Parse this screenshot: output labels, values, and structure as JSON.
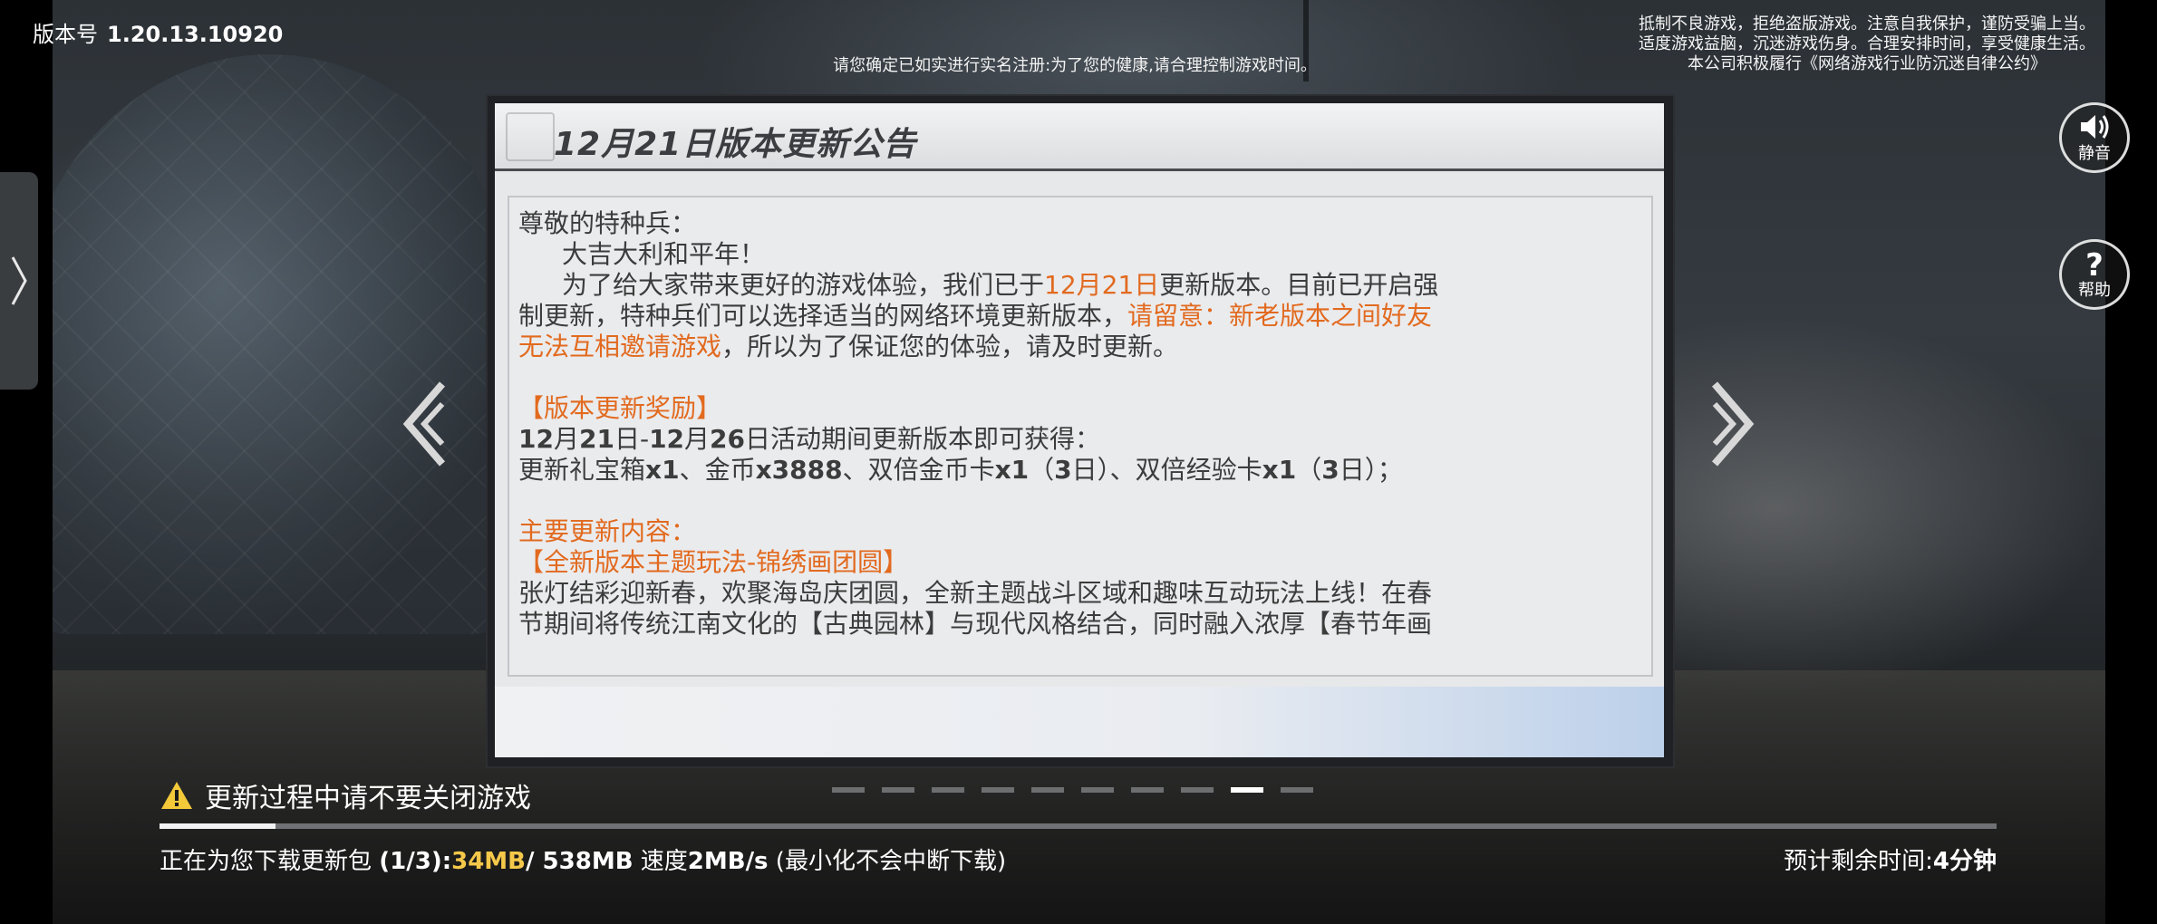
{
  "version": {
    "label": "版本号",
    "value": "1.20.13.10920"
  },
  "notice_realname": "请您确定已如实进行实名注册:为了您的健康,请合理控制游戏时间。",
  "health_notice": [
    "抵制不良游戏，拒绝盗版游戏。注意自我保护，谨防受骗上当。",
    "适度游戏益脑，沉迷游戏伤身。合理安排时间，享受健康生活。",
    "本公司积极履行《网络游戏行业防沉迷自律公约》"
  ],
  "buttons": {
    "mute": "静音",
    "help": "帮助"
  },
  "announcement": {
    "title": "12月21日版本更新公告",
    "greeting": "尊敬的特种兵：",
    "wish": "大吉大利和平年！",
    "p1_a": "为了给大家带来更好的游戏体验，我们已于",
    "p1_date": "12月21日",
    "p1_b": "更新版本。目前已开启强",
    "p2_a": "制更新，特种兵们可以选择适当的网络环境更新版本，",
    "p2_warn": "请留意：新老版本之间好友",
    "p3_warn": "无法互相邀请游戏",
    "p3_b": "，所以为了保证您的体验，请及时更新。",
    "reward_title": "【版本更新奖励】",
    "reward_period_a": "12",
    "reward_period_b": "月",
    "reward_period_c": "21",
    "reward_period_d": "日-",
    "reward_period_e": "12",
    "reward_period_f": "月",
    "reward_period_g": "26",
    "reward_period_h": "日活动期间更新版本即可获得：",
    "rewards": {
      "t1": "更新礼宝箱",
      "v1": "x1",
      "t2": "、金币",
      "v2": "x3888",
      "t3": "、双倍金币卡",
      "v3": "x1",
      "t4": "（",
      "v4": "3",
      "t5": "日）、双倍经验卡",
      "v5": "x1",
      "t6": "（",
      "v6": "3",
      "t7": "日）；"
    },
    "main_title": "主要更新内容：",
    "mode_title": "【全新版本主题玩法-锦绣画团圆】",
    "mode_p1": "张灯结彩迎新春，欢聚海岛庆团圆，全新主题战斗区域和趣味互动玩法上线！在春",
    "mode_p2": "节期间将传统江南文化的【古典园林】与现代风格结合，同时融入浓厚【春节年画"
  },
  "pager": {
    "count": 10,
    "active_index": 8
  },
  "warning_text": "更新过程中请不要关闭游戏",
  "progress": {
    "fraction": 0.063
  },
  "download": {
    "prefix": "正在为您下载更新包 ",
    "part": "(1/3):",
    "done": "34MB",
    "sep": "/ ",
    "total": "538MB",
    "speed_label": " 速度",
    "speed": "2MB/s",
    "note": " (最小化不会中断下载)"
  },
  "eta": {
    "label": "预计剩余时间:",
    "value": "4分钟"
  },
  "icons": [
    "chevron-right-icon",
    "speaker-icon",
    "question-icon",
    "double-chevron-left-icon",
    "double-chevron-right-icon",
    "warning-icon"
  ]
}
